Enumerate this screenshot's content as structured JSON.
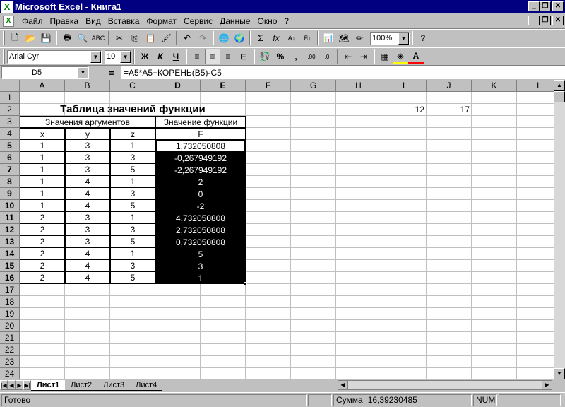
{
  "window": {
    "title": "Microsoft Excel - Книга1"
  },
  "menu": {
    "items": [
      "Файл",
      "Правка",
      "Вид",
      "Вставка",
      "Формат",
      "Сервис",
      "Данные",
      "Окно",
      "?"
    ]
  },
  "toolbar": {
    "zoom": "100%"
  },
  "format": {
    "font": "Arial Cyr",
    "size": "10",
    "bold": "Ж",
    "italic": "К",
    "underline": "Ч",
    "percent": "%",
    "comma": ","
  },
  "formula_bar": {
    "name_box": "D5",
    "equals": "=",
    "formula": "=A5*A5+КОРЕНЬ(B5)-C5"
  },
  "columns": [
    "A",
    "B",
    "C",
    "D",
    "E",
    "F",
    "G",
    "H",
    "I",
    "J",
    "K",
    "L"
  ],
  "rows": [
    "1",
    "2",
    "3",
    "4",
    "5",
    "6",
    "7",
    "8",
    "9",
    "10",
    "11",
    "12",
    "13",
    "14",
    "15",
    "16",
    "17",
    "18",
    "19",
    "20",
    "21",
    "22",
    "23",
    "24"
  ],
  "sheet": {
    "title": "Таблица значений функции",
    "args_header": "Значения аргументов",
    "func_header": "Значение функции",
    "col_x": "x",
    "col_y": "y",
    "col_z": "z",
    "col_f": "F",
    "I2": "12",
    "J2": "17",
    "data": [
      [
        "1",
        "3",
        "1",
        "1,732050808"
      ],
      [
        "1",
        "3",
        "3",
        "-0,267949192"
      ],
      [
        "1",
        "3",
        "5",
        "-2,267949192"
      ],
      [
        "1",
        "4",
        "1",
        "2"
      ],
      [
        "1",
        "4",
        "3",
        "0"
      ],
      [
        "1",
        "4",
        "5",
        "-2"
      ],
      [
        "2",
        "3",
        "1",
        "4,732050808"
      ],
      [
        "2",
        "3",
        "3",
        "2,732050808"
      ],
      [
        "2",
        "3",
        "5",
        "0,732050808"
      ],
      [
        "2",
        "4",
        "1",
        "5"
      ],
      [
        "2",
        "4",
        "3",
        "3"
      ],
      [
        "2",
        "4",
        "5",
        "1"
      ]
    ]
  },
  "sheet_tabs": [
    "Лист1",
    "Лист2",
    "Лист3",
    "Лист4"
  ],
  "status": {
    "ready": "Готово",
    "sum": "Сумма=16,39230485",
    "num": "NUM"
  }
}
